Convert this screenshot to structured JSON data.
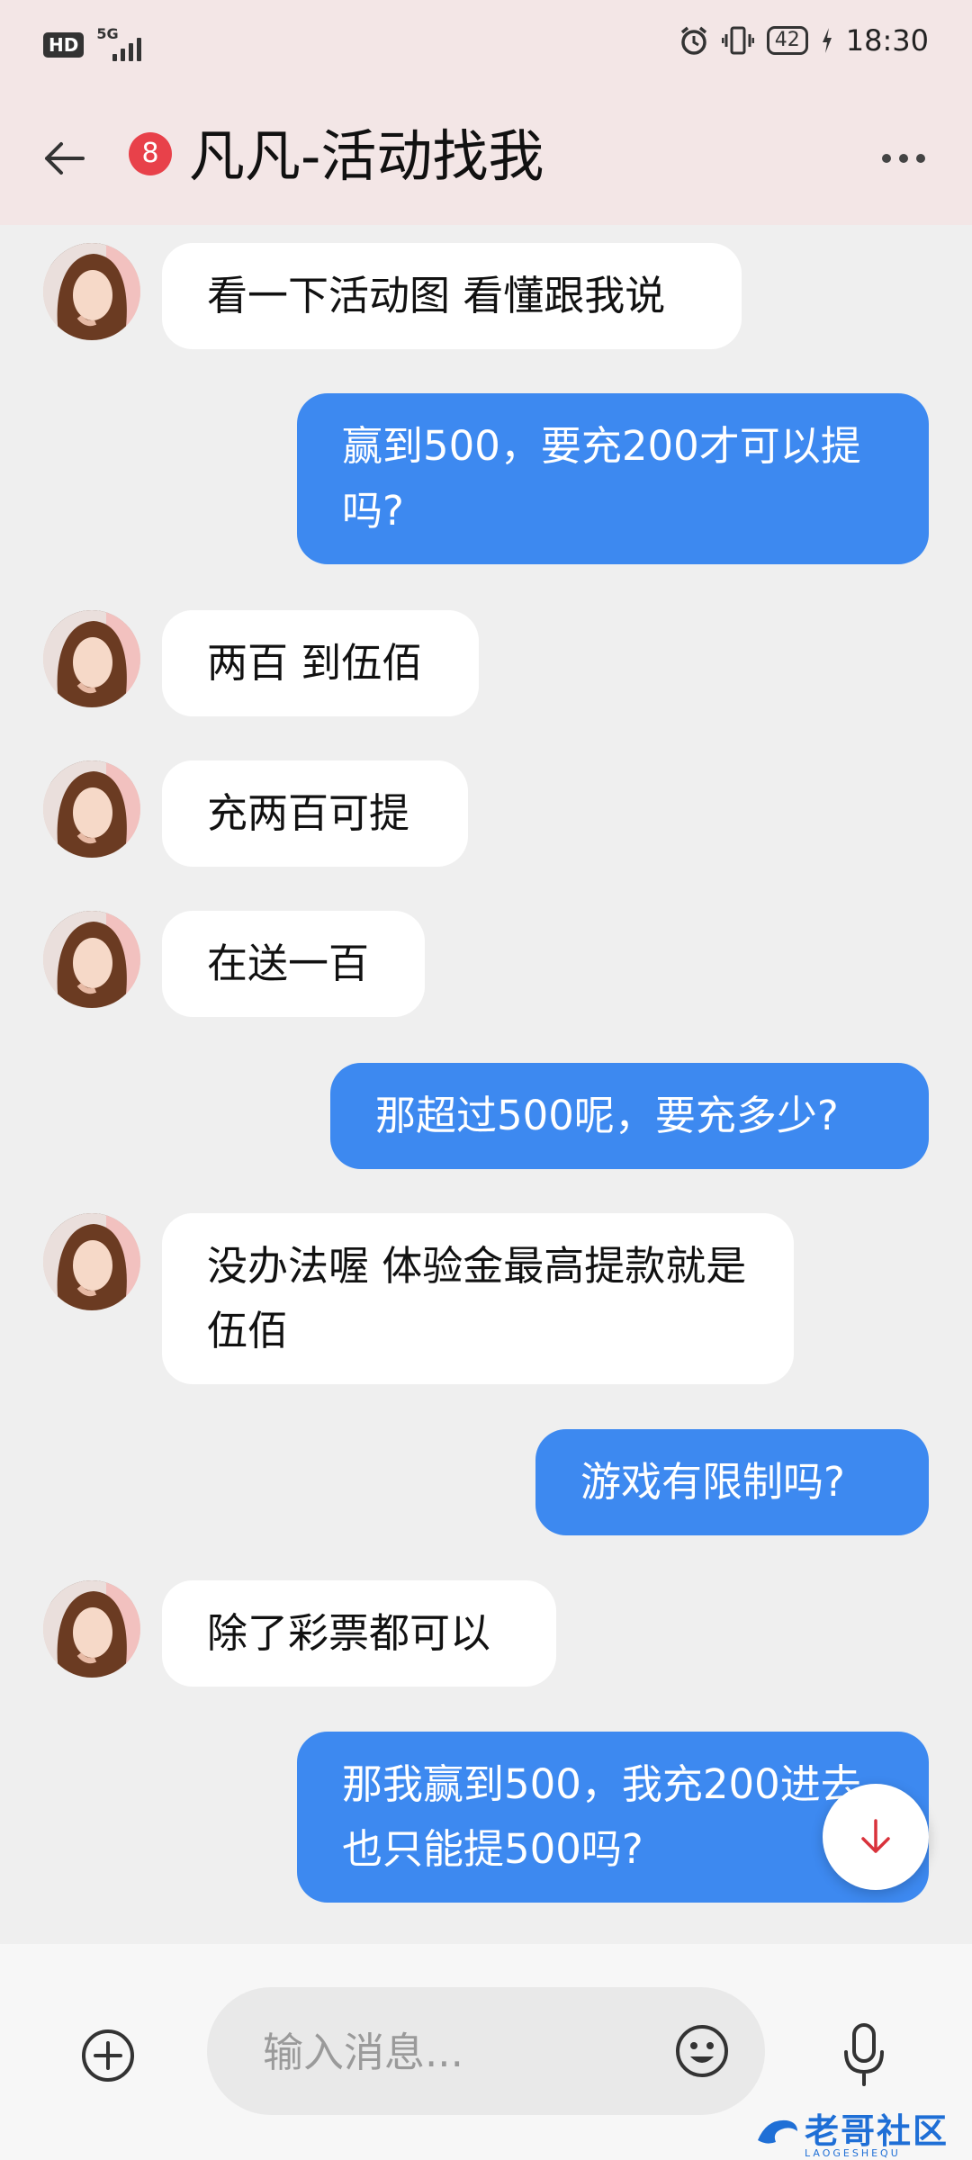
{
  "status_bar": {
    "hd_label": "HD",
    "network_label": "5G",
    "battery": "42",
    "time": "18:30",
    "icons": [
      "alarm-icon",
      "vibrate-icon",
      "battery-icon",
      "charging-icon"
    ]
  },
  "header": {
    "unread_count": "8",
    "title": "凡凡-活动找我",
    "icons": [
      "back-arrow-icon",
      "more-dots-icon"
    ]
  },
  "messages": [
    {
      "side": "in",
      "text": "看一下活动图 看懂跟我说"
    },
    {
      "side": "out",
      "text": "赢到500，要充200才可以提吗?"
    },
    {
      "side": "in",
      "text": "两百 到伍佰"
    },
    {
      "side": "in",
      "text": "充两百可提"
    },
    {
      "side": "in",
      "text": "在送一百"
    },
    {
      "side": "out",
      "text": "那超过500呢，要充多少?"
    },
    {
      "side": "in",
      "text": "没办法喔 体验金最高提款就是伍佰"
    },
    {
      "side": "out",
      "text": "游戏有限制吗?"
    },
    {
      "side": "in",
      "text": "除了彩票都可以"
    },
    {
      "side": "out",
      "text": "那我赢到500，我充200进去也只能提500吗?"
    }
  ],
  "input_bar": {
    "placeholder": "输入消息...",
    "icons": [
      "add-circle-icon",
      "emoji-icon",
      "microphone-icon"
    ]
  },
  "watermark": {
    "text": "老哥社区",
    "sub": "LAOGESHEQU"
  },
  "colors": {
    "header_bg": "#f3e6e6",
    "chat_bg": "#efefef",
    "outgoing_bubble": "#3d89f0",
    "incoming_bubble": "#ffffff",
    "badge": "#e8414a",
    "fab_arrow": "#d9323b"
  }
}
